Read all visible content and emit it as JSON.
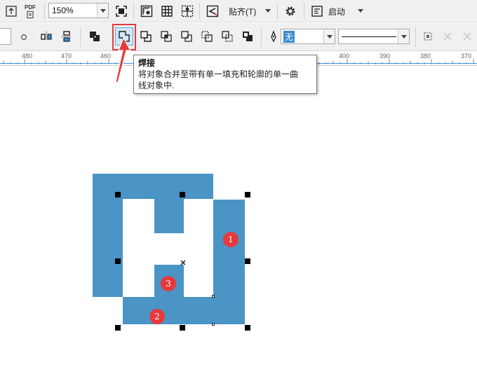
{
  "toolbar_top": {
    "zoom_value": "150%",
    "snap_label": "贴齐(T)",
    "launch_label": "启动",
    "pdf_label": "PDF"
  },
  "toolbar_props": {
    "fill_value": "无"
  },
  "ruler": {
    "labels": [
      "480",
      "470",
      "460",
      "400",
      "390",
      "380",
      "370"
    ]
  },
  "tooltip": {
    "title": "焊接",
    "description_line1": "将对象合并至带有单一填充和轮廓的单一曲",
    "description_line2": "线对象中."
  },
  "canvas": {
    "badges": [
      "1",
      "2",
      "3"
    ]
  },
  "colors": {
    "shape_fill": "#4a94c6",
    "highlight_outline": "#e63a3a",
    "arrow_red": "#e63a3a",
    "active_button": "#cfe6f7"
  }
}
